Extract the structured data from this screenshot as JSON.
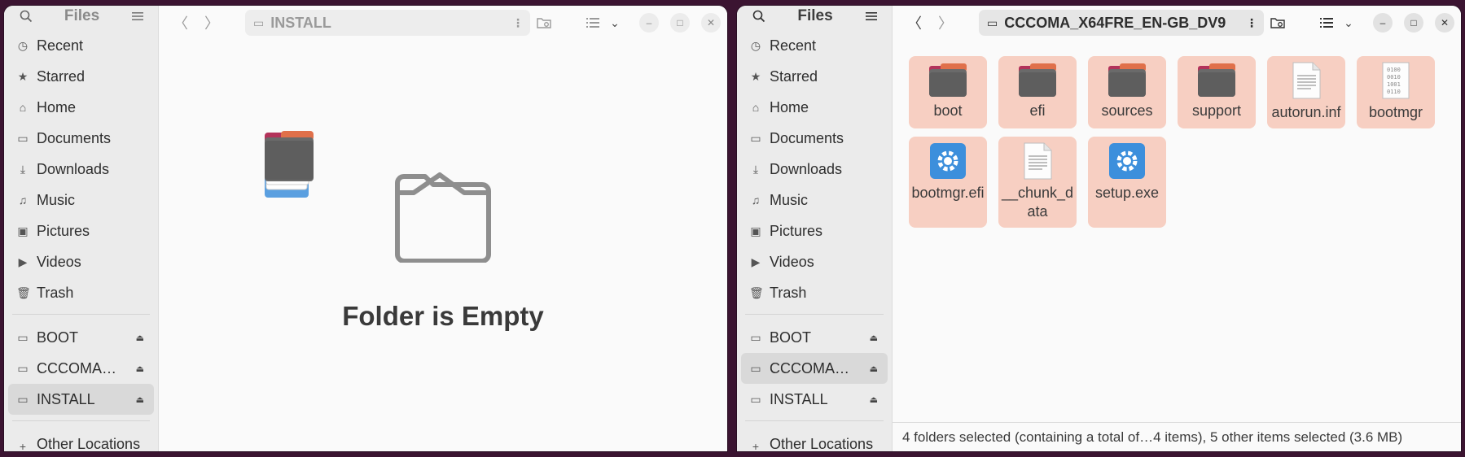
{
  "left_window": {
    "sidebar_title": "Files",
    "path": "INSTALL",
    "empty_message": "Folder is Empty",
    "sidebar": {
      "places": [
        {
          "label": "Recent",
          "icon": "clock-icon"
        },
        {
          "label": "Starred",
          "icon": "star-icon"
        },
        {
          "label": "Home",
          "icon": "home-icon"
        },
        {
          "label": "Documents",
          "icon": "document-icon"
        },
        {
          "label": "Downloads",
          "icon": "download-icon"
        },
        {
          "label": "Music",
          "icon": "music-icon"
        },
        {
          "label": "Pictures",
          "icon": "picture-icon"
        },
        {
          "label": "Videos",
          "icon": "video-icon"
        },
        {
          "label": "Trash",
          "icon": "trash-icon"
        }
      ],
      "drives": [
        {
          "label": "BOOT"
        },
        {
          "label": "CCCOMA…"
        },
        {
          "label": "INSTALL",
          "active": true
        }
      ],
      "other": "Other Locations"
    }
  },
  "right_window": {
    "sidebar_title": "Files",
    "path": "CCCOMA_X64FRE_EN-GB_DV9",
    "sidebar": {
      "places": [
        {
          "label": "Recent"
        },
        {
          "label": "Starred"
        },
        {
          "label": "Home"
        },
        {
          "label": "Documents"
        },
        {
          "label": "Downloads"
        },
        {
          "label": "Music"
        },
        {
          "label": "Pictures"
        },
        {
          "label": "Videos"
        },
        {
          "label": "Trash"
        }
      ],
      "drives": [
        {
          "label": "BOOT"
        },
        {
          "label": "CCCOMA…",
          "active": true
        },
        {
          "label": "INSTALL"
        }
      ],
      "other": "Other Locations"
    },
    "files": [
      {
        "name": "boot",
        "type": "folder"
      },
      {
        "name": "efi",
        "type": "folder"
      },
      {
        "name": "sources",
        "type": "folder"
      },
      {
        "name": "support",
        "type": "folder"
      },
      {
        "name": "autorun.inf",
        "type": "text"
      },
      {
        "name": "bootmgr",
        "type": "binary"
      },
      {
        "name": "bootmgr.efi",
        "type": "exec"
      },
      {
        "name": "__chunk_data",
        "type": "text"
      },
      {
        "name": "setup.exe",
        "type": "exec"
      }
    ],
    "status": "4 folders selected (containing a total of…4 items), 5 other items selected (3.6 MB)"
  },
  "colors": {
    "selection": "#f7cfc2",
    "folder_tab": "#b3325a",
    "folder_body": "#6a6a6a",
    "exec_blue": "#3c8fdc",
    "desktop": "#3b1431"
  }
}
